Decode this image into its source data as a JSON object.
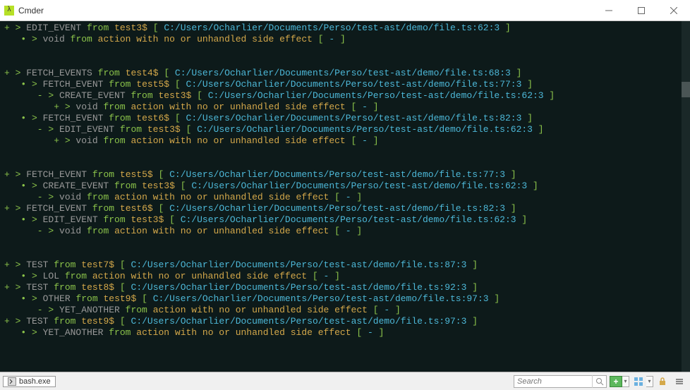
{
  "window": {
    "title": "Cmder"
  },
  "terminal": {
    "lines": [
      {
        "indent": 0,
        "prefix": "+ > ",
        "kw": "EDIT_EVENT",
        "from": "from",
        "src": "test3$",
        "lb": "[ ",
        "path": "C:/Users/Ocharlier/Documents/Perso/test-ast/demo/file.ts:62:3",
        "rb": " ]"
      },
      {
        "indent": 1,
        "prefix": "• > ",
        "kw": "void",
        "from": "from",
        "msg": "action with no or unhandled side effect",
        "lb": "[ ",
        "dash": "-",
        "rb": " ]"
      },
      {
        "blank": true
      },
      {
        "blank": true
      },
      {
        "indent": 0,
        "prefix": "+ > ",
        "kw": "FETCH_EVENTS",
        "from": "from",
        "src": "test4$",
        "lb": "[ ",
        "path": "C:/Users/Ocharlier/Documents/Perso/test-ast/demo/file.ts:68:3",
        "rb": " ]"
      },
      {
        "indent": 1,
        "prefix": "• > ",
        "kw": "FETCH_EVENT",
        "from": "from",
        "src": "test5$",
        "lb": "[ ",
        "path": "C:/Users/Ocharlier/Documents/Perso/test-ast/demo/file.ts:77:3",
        "rb": " ]"
      },
      {
        "indent": 2,
        "prefix": "- > ",
        "kw": "CREATE_EVENT",
        "from": "from",
        "src": "test3$",
        "lb": "[ ",
        "path": "C:/Users/Ocharlier/Documents/Perso/test-ast/demo/file.ts:62:3",
        "rb": " ]"
      },
      {
        "indent": 3,
        "prefix": "+ > ",
        "kw": "void",
        "from": "from",
        "msg": "action with no or unhandled side effect",
        "lb": "[ ",
        "dash": "-",
        "rb": " ]"
      },
      {
        "indent": 1,
        "prefix": "• > ",
        "kw": "FETCH_EVENT",
        "from": "from",
        "src": "test6$",
        "lb": "[ ",
        "path": "C:/Users/Ocharlier/Documents/Perso/test-ast/demo/file.ts:82:3",
        "rb": " ]"
      },
      {
        "indent": 2,
        "prefix": "- > ",
        "kw": "EDIT_EVENT",
        "from": "from",
        "src": "test3$",
        "lb": "[ ",
        "path": "C:/Users/Ocharlier/Documents/Perso/test-ast/demo/file.ts:62:3",
        "rb": " ]"
      },
      {
        "indent": 3,
        "prefix": "+ > ",
        "kw": "void",
        "from": "from",
        "msg": "action with no or unhandled side effect",
        "lb": "[ ",
        "dash": "-",
        "rb": " ]"
      },
      {
        "blank": true
      },
      {
        "blank": true
      },
      {
        "indent": 0,
        "prefix": "+ > ",
        "kw": "FETCH_EVENT",
        "from": "from",
        "src": "test5$",
        "lb": "[ ",
        "path": "C:/Users/Ocharlier/Documents/Perso/test-ast/demo/file.ts:77:3",
        "rb": " ]"
      },
      {
        "indent": 1,
        "prefix": "• > ",
        "kw": "CREATE_EVENT",
        "from": "from",
        "src": "test3$",
        "lb": "[ ",
        "path": "C:/Users/Ocharlier/Documents/Perso/test-ast/demo/file.ts:62:3",
        "rb": " ]"
      },
      {
        "indent": 2,
        "prefix": "- > ",
        "kw": "void",
        "from": "from",
        "msg": "action with no or unhandled side effect",
        "lb": "[ ",
        "dash": "-",
        "rb": " ]"
      },
      {
        "indent": 0,
        "prefix": "+ > ",
        "kw": "FETCH_EVENT",
        "from": "from",
        "src": "test6$",
        "lb": "[ ",
        "path": "C:/Users/Ocharlier/Documents/Perso/test-ast/demo/file.ts:82:3",
        "rb": " ]"
      },
      {
        "indent": 1,
        "prefix": "• > ",
        "kw": "EDIT_EVENT",
        "from": "from",
        "src": "test3$",
        "lb": "[ ",
        "path": "C:/Users/Ocharlier/Documents/Perso/test-ast/demo/file.ts:62:3",
        "rb": " ]"
      },
      {
        "indent": 2,
        "prefix": "- > ",
        "kw": "void",
        "from": "from",
        "msg": "action with no or unhandled side effect",
        "lb": "[ ",
        "dash": "-",
        "rb": " ]"
      },
      {
        "blank": true
      },
      {
        "blank": true
      },
      {
        "indent": 0,
        "prefix": "+ > ",
        "kw": "TEST",
        "from": "from",
        "src": "test7$",
        "lb": "[ ",
        "path": "C:/Users/Ocharlier/Documents/Perso/test-ast/demo/file.ts:87:3",
        "rb": " ]"
      },
      {
        "indent": 1,
        "prefix": "• > ",
        "kw": "LOL",
        "from": "from",
        "msg": "action with no or unhandled side effect",
        "lb": "[ ",
        "dash": "-",
        "rb": " ]"
      },
      {
        "indent": 0,
        "prefix": "+ > ",
        "kw": "TEST",
        "from": "from",
        "src": "test8$",
        "lb": "[ ",
        "path": "C:/Users/Ocharlier/Documents/Perso/test-ast/demo/file.ts:92:3",
        "rb": " ]"
      },
      {
        "indent": 1,
        "prefix": "• > ",
        "kw": "OTHER",
        "from": "from",
        "src": "test9$",
        "lb": "[ ",
        "path": "C:/Users/Ocharlier/Documents/Perso/test-ast/demo/file.ts:97:3",
        "rb": " ]"
      },
      {
        "indent": 2,
        "prefix": "- > ",
        "kw": "YET_ANOTHER",
        "from": "from",
        "msg": "action with no or unhandled side effect",
        "lb": "[ ",
        "dash": "-",
        "rb": " ]"
      },
      {
        "indent": 0,
        "prefix": "+ > ",
        "kw": "TEST",
        "from": "from",
        "src": "test9$",
        "lb": "[ ",
        "path": "C:/Users/Ocharlier/Documents/Perso/test-ast/demo/file.ts:97:3",
        "rb": " ]"
      },
      {
        "indent": 1,
        "prefix": "• > ",
        "kw": "YET_ANOTHER",
        "from": "from",
        "msg": "action with no or unhandled side effect",
        "lb": "[ ",
        "dash": "-",
        "rb": " ]"
      }
    ]
  },
  "statusbar": {
    "tab_label": "bash.exe",
    "search_placeholder": "Search"
  }
}
